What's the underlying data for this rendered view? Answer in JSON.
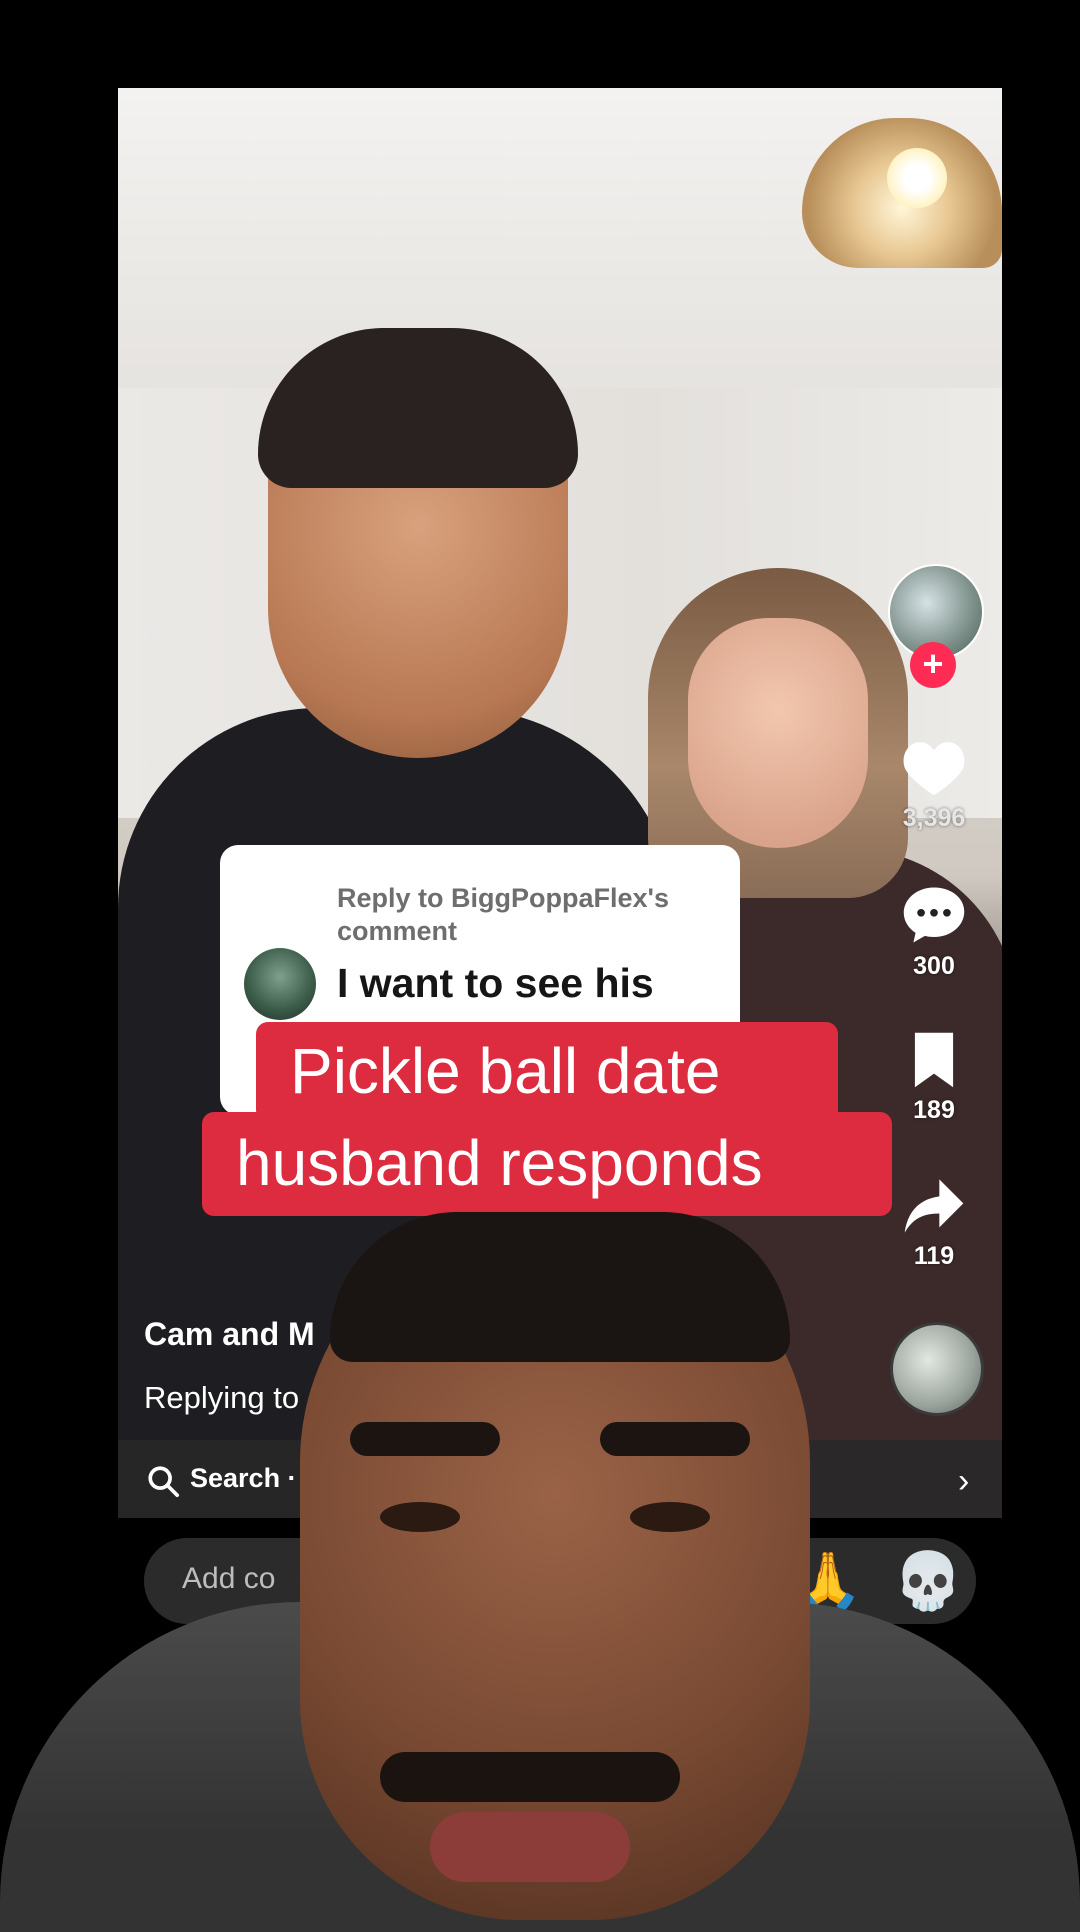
{
  "video": {
    "author": "Cam and M",
    "replying": "Replying to",
    "search": "Search ·",
    "comment_placeholder": "Add co",
    "emoji_pray": "🙏",
    "emoji_skull": "💀"
  },
  "rail": {
    "likes": "3,396",
    "comments": "300",
    "saves": "189",
    "shares": "119"
  },
  "reply": {
    "to": "Reply to BiggPoppaFlex's comment",
    "comment": "I want to see his"
  },
  "caption": {
    "line1": "Pickle ball date",
    "line2": "husband responds"
  },
  "colors": {
    "caption_bg": "#dd2c40",
    "follow_plus": "#fe2c55"
  }
}
